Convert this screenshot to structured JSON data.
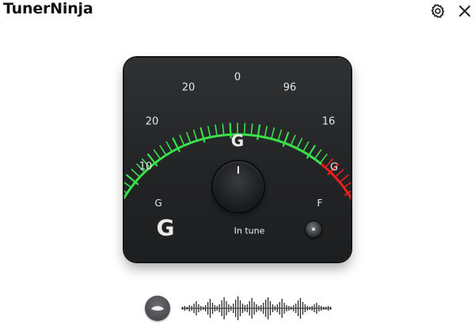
{
  "app": {
    "title": "TunerNinja"
  },
  "titlebar": {
    "settings_icon": "gear-icon",
    "close_icon": "close-icon"
  },
  "gauge": {
    "scale_labels": [
      "10",
      "20",
      "20",
      "0",
      "96",
      "16",
      "G"
    ],
    "colors": {
      "in_tune": "#39e04a",
      "sharp": "#e5201d",
      "tick_dim": "#2c8f36"
    }
  },
  "tuner": {
    "detected_note": "G",
    "left_string_label": "G",
    "left_note": "G",
    "right_label": "F",
    "status": "In tune"
  },
  "bottom": {
    "mic_icon": "mic-icon",
    "waveform_icon": "waveform-icon"
  },
  "colors": {
    "panel": "#222325",
    "accent_green": "#39e04a",
    "accent_red": "#e5201d"
  }
}
